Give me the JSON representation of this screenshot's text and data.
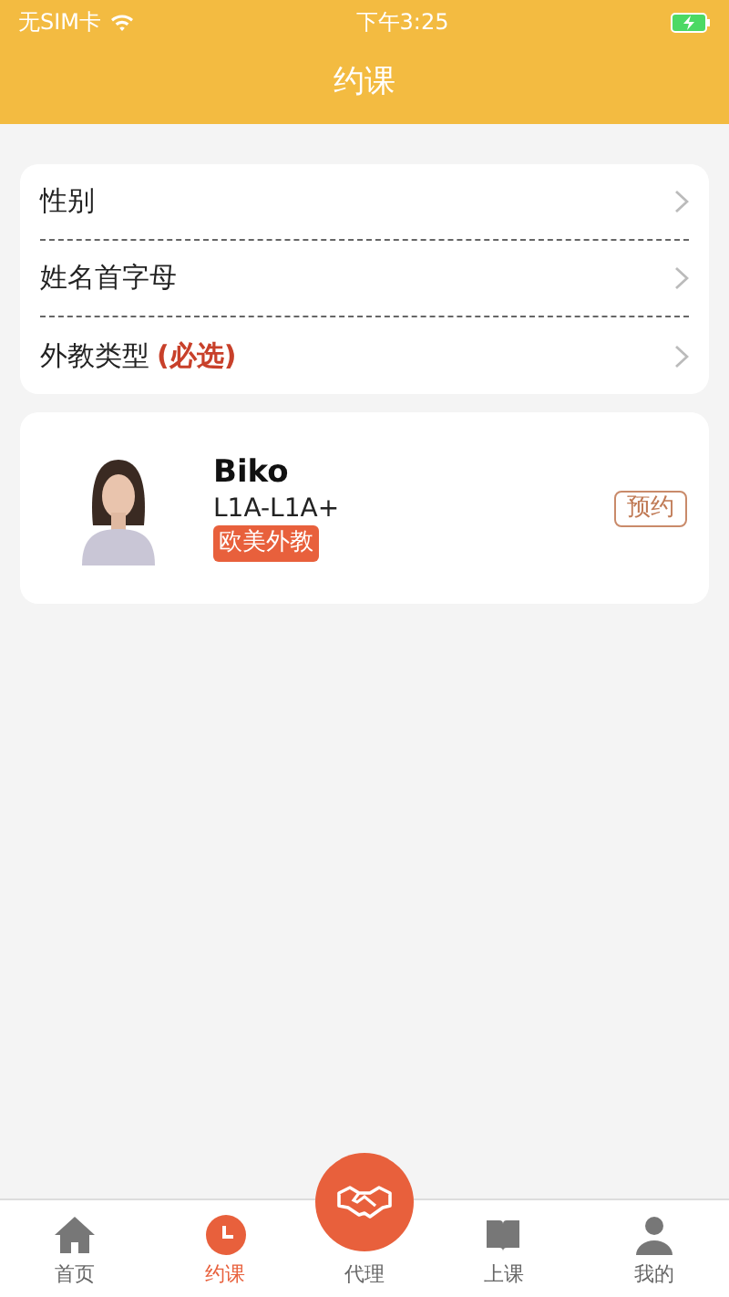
{
  "status_bar": {
    "carrier": "无SIM卡",
    "time": "下午3:25"
  },
  "header": {
    "title": "约课"
  },
  "filters": [
    {
      "label": "性别"
    },
    {
      "label": "姓名首字母"
    },
    {
      "label": "外教类型",
      "note": "(必选)"
    }
  ],
  "teachers": [
    {
      "name": "Biko",
      "level_range": "L1A-L1A+",
      "tag": "欧美外教",
      "action": "预约"
    }
  ],
  "tab_bar": [
    {
      "label": "首页",
      "kind": "home",
      "selected": false
    },
    {
      "label": "约课",
      "kind": "clock",
      "selected": true
    },
    {
      "label": "代理",
      "kind": "center",
      "selected": false
    },
    {
      "label": "上课",
      "kind": "book",
      "selected": false
    },
    {
      "label": "我的",
      "kind": "person",
      "selected": false
    }
  ]
}
